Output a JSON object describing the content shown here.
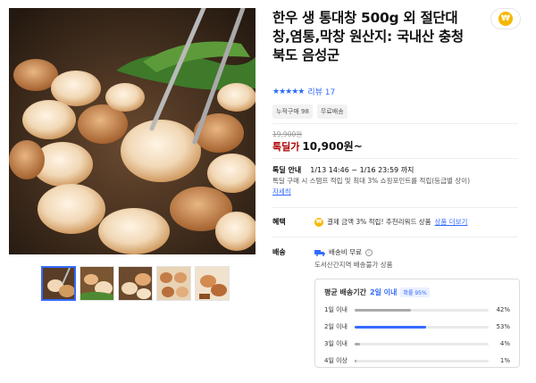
{
  "product": {
    "title": "한우 생 통대창 500g 외 절단대창,염통,막창 원산지: 국내산 충청북도 음성군",
    "rating_stars": "★★★★★",
    "review_label": "리뷰 17",
    "tags": [
      "누적구매 98",
      "무료배송"
    ],
    "original_price": "19,900원",
    "sale_label": "톡딜가",
    "sale_price": "10,900원~",
    "deal_label": "톡딜 안내",
    "deal_period": "1/13 14:46 ~ 1/16 23:59 까지",
    "deal_desc": "톡딜 구매 시 스탬프 적립 및 최대 3% 쇼핑포인트를 적립(등급별 상이)",
    "deal_link": "자세히"
  },
  "benefit": {
    "label": "혜택",
    "text": "결제 금액 3% 적립! 추천리워드 상품",
    "link": "상품 더보기",
    "coin": "₩"
  },
  "shipping": {
    "label": "배송",
    "fee": "배송비 무료",
    "note": "도서산간지역 배송불가 상품",
    "avg_title": "평균 배송기간",
    "avg_value": "2일 이내",
    "avg_badge": "확률 95%",
    "rows": [
      {
        "label": "1일 이내",
        "pct": "42%",
        "value": 0.42
      },
      {
        "label": "2일 이내",
        "pct": "53%",
        "value": 0.53
      },
      {
        "label": "3일 이내",
        "pct": "4%",
        "value": 0.04
      },
      {
        "label": "4일 이상",
        "pct": "1%",
        "value": 0.01
      }
    ]
  },
  "brand_badge": "₩",
  "colors": {
    "accent": "#346aff",
    "sale": "#ae0000",
    "coin": "#f5b700"
  },
  "icons": [
    "star-icon",
    "coin-icon",
    "truck-icon",
    "info-icon"
  ]
}
